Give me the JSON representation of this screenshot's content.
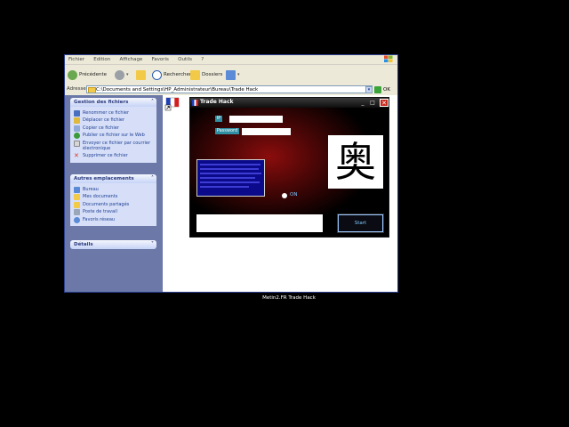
{
  "explorer": {
    "menu": [
      "Fichier",
      "Edition",
      "Affichage",
      "Favoris",
      "Outils",
      "?"
    ],
    "toolbar": {
      "back_label": "Précédente",
      "search_label": "Rechercher",
      "folders_label": "Dossiers"
    },
    "address": {
      "label": "Adresse",
      "value": "C:\\Documents and Settings\\HP_Administrateur\\Bureau\\Trade Hack",
      "go_label": "OK"
    },
    "file_tasks": {
      "title": "Gestion des fichiers",
      "items": [
        "Renommer ce fichier",
        "Déplacer ce fichier",
        "Copier ce fichier",
        "Publier ce fichier sur le Web",
        "Envoyer ce fichier par courrier électronique",
        "Supprimer ce fichier"
      ]
    },
    "other_places": {
      "title": "Autres emplacements",
      "items": [
        "Bureau",
        "Mes documents",
        "Documents partagés",
        "Poste de travail",
        "Favoris réseau"
      ]
    },
    "details": {
      "title": "Détails"
    }
  },
  "tradehack": {
    "title": "Trade Hack",
    "ip_label": "IP",
    "password_label": "Password",
    "on_label": "ON",
    "start_label": "Start",
    "logo_char": "奥"
  },
  "desktop": {
    "icon_label": "Metin2.FR Trade Hack"
  },
  "colors": {
    "titlebar": "#0e0e0e",
    "accent_red": "#8b0d0d",
    "sidepanel": "#6b78a8",
    "label_teal": "#2f8fa3"
  }
}
